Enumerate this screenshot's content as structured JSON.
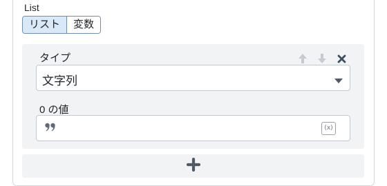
{
  "list": {
    "label": "List",
    "modes": [
      {
        "label": "リスト",
        "active": true
      },
      {
        "label": "変数",
        "active": false
      }
    ]
  },
  "item": {
    "type_label": "タイプ",
    "type_value": "文字列",
    "value_label": "0 の値",
    "value_text": "",
    "variable_icon_text": "(x)"
  },
  "icons": {
    "move_up": "arrow-up-icon",
    "move_down": "arrow-down-icon",
    "remove": "close-icon",
    "caret": "caret-down-icon",
    "quote": "quote-icon",
    "add": "plus-icon"
  },
  "colors": {
    "accent_border": "#6c8db5",
    "active_segment": "#d9e9f7",
    "card_bg": "#f2f3f5",
    "icon_muted": "#c7cbd1",
    "icon_dark": "#3d4d63"
  }
}
